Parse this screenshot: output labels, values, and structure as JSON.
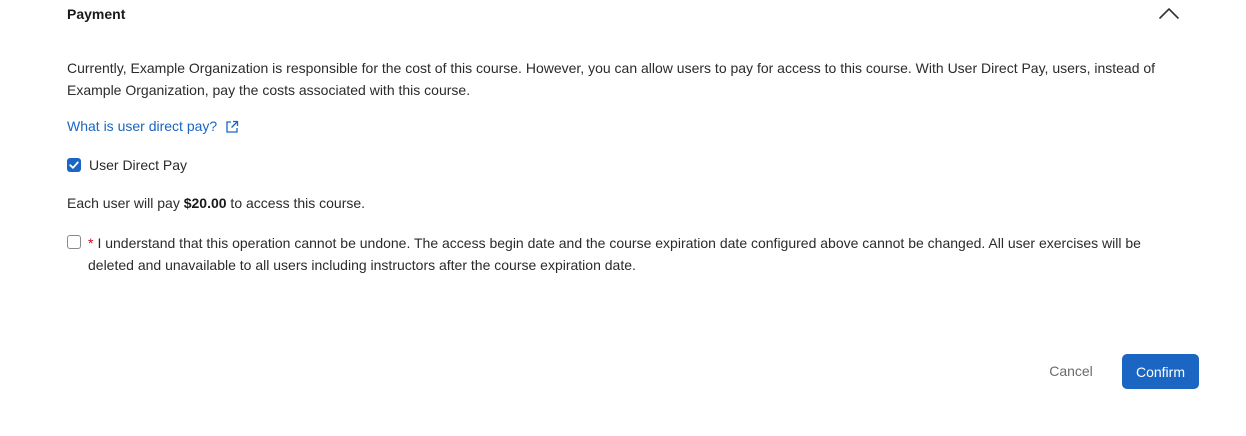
{
  "section": {
    "title": "Payment",
    "toggle_icon": "chevron-up-icon"
  },
  "description": "Currently, Example Organization is responsible for the cost of this course. However, you can allow users to pay for access to this course. With User Direct Pay, users, instead of Example Organization, pay the costs associated with this course.",
  "help_link": {
    "label": "What is user direct pay?",
    "icon": "external-link-icon"
  },
  "user_direct_pay": {
    "label": "User Direct Pay",
    "checked": true
  },
  "price": {
    "prefix": "Each user will pay ",
    "amount": "$20.00",
    "suffix": " to access this course."
  },
  "acknowledgement": {
    "required_marker": "*",
    "text": "I understand that this operation cannot be undone. The access begin date and the course expiration date configured above cannot be changed. All user exercises will be deleted and unavailable to all users including instructors after the course expiration date.",
    "checked": false
  },
  "actions": {
    "cancel_label": "Cancel",
    "confirm_label": "Confirm"
  },
  "colors": {
    "accent": "#1a66c2",
    "required": "#d0021b"
  }
}
